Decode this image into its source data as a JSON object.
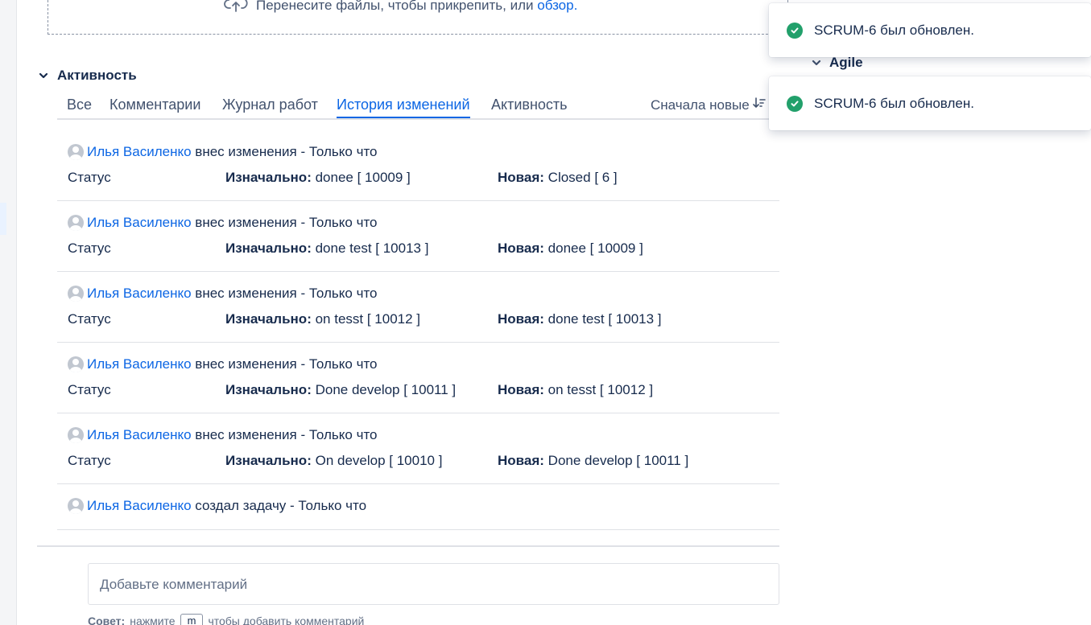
{
  "dropzone": {
    "text": "Перенесите файлы, чтобы прикрепить, или",
    "link": "обзор."
  },
  "activity": {
    "title": "Активность",
    "tabs": [
      "Все",
      "Комментарии",
      "Журнал работ",
      "История изменений",
      "Активность"
    ],
    "active_tab": "История изменений",
    "sort_label": "Сначала новые"
  },
  "entries": [
    {
      "user": "Илья Василенко",
      "action": "внес изменения - Только что",
      "field": "Статус",
      "from_label": "Изначально:",
      "from": "donee [ 10009 ]",
      "to_label": "Новая:",
      "to": "Closed [ 6 ]"
    },
    {
      "user": "Илья Василенко",
      "action": "внес изменения - Только что",
      "field": "Статус",
      "from_label": "Изначально:",
      "from": "done test [ 10013 ]",
      "to_label": "Новая:",
      "to": "donee [ 10009 ]"
    },
    {
      "user": "Илья Василенко",
      "action": "внес изменения - Только что",
      "field": "Статус",
      "from_label": "Изначально:",
      "from": "on tesst [ 10012 ]",
      "to_label": "Новая:",
      "to": "done test [ 10013 ]"
    },
    {
      "user": "Илья Василенко",
      "action": "внес изменения - Только что",
      "field": "Статус",
      "from_label": "Изначально:",
      "from": "Done develop [ 10011 ]",
      "to_label": "Новая:",
      "to": "on tesst [ 10012 ]"
    },
    {
      "user": "Илья Василенко",
      "action": "внес изменения - Только что",
      "field": "Статус",
      "from_label": "Изначально:",
      "from": "On develop [ 10010 ]",
      "to_label": "Новая:",
      "to": "Done develop [ 10011 ]"
    }
  ],
  "created_entry": {
    "user": "Илья Василенко",
    "action": "создал задачу - Только что"
  },
  "comment": {
    "placeholder": "Добавьте комментарий"
  },
  "tip": {
    "label": "Совет:",
    "before": "нажмите",
    "key": "m",
    "after": "чтобы добавить комментарий"
  },
  "right_panel": {
    "section": "Agile"
  },
  "toasts": [
    {
      "message": "SCRUM-6 был обновлен."
    },
    {
      "message": "SCRUM-6 был обновлен."
    }
  ],
  "colors": {
    "link": "#0c66e4",
    "success": "#22a06b",
    "text": "#172b4d"
  },
  "icons": [
    "cloud-upload-icon",
    "chevron-down-icon",
    "sort-icon",
    "avatar-icon",
    "check-circle-icon"
  ]
}
